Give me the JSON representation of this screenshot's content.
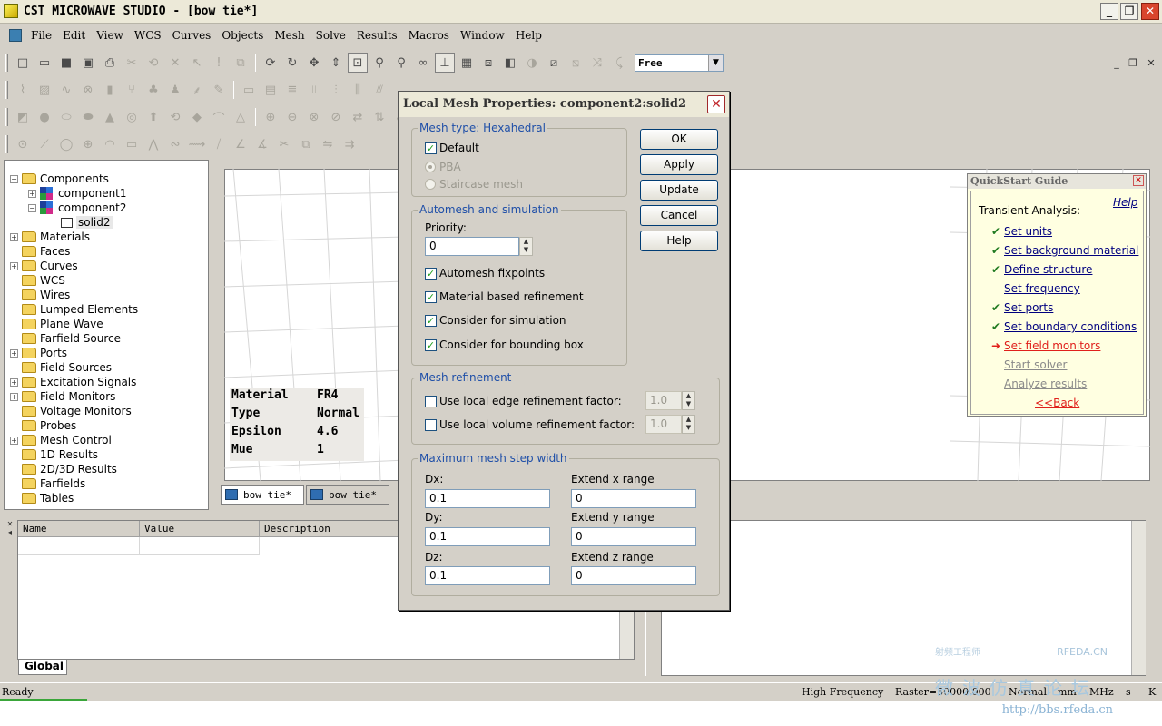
{
  "window": {
    "title": "CST MICROWAVE STUDIO - [bow tie*]",
    "min_glyph": "_",
    "max_glyph": "❐",
    "close_glyph": "✕"
  },
  "menu": [
    "File",
    "Edit",
    "View",
    "WCS",
    "Curves",
    "Objects",
    "Mesh",
    "Solve",
    "Results",
    "Macros",
    "Window",
    "Help"
  ],
  "toolbar": {
    "mode_combo": "Free",
    "combo_arrow": "▼"
  },
  "tree": {
    "items": [
      {
        "label": "Components",
        "exp": "−"
      },
      {
        "label": "component1",
        "exp": "+"
      },
      {
        "label": "component2",
        "exp": "−"
      },
      {
        "label": "solid2",
        "exp": ""
      },
      {
        "label": "Materials",
        "exp": "+"
      },
      {
        "label": "Faces",
        "exp": ""
      },
      {
        "label": "Curves",
        "exp": "+"
      },
      {
        "label": "WCS",
        "exp": ""
      },
      {
        "label": "Wires",
        "exp": ""
      },
      {
        "label": "Lumped Elements",
        "exp": ""
      },
      {
        "label": "Plane Wave",
        "exp": ""
      },
      {
        "label": "Farfield Source",
        "exp": ""
      },
      {
        "label": "Ports",
        "exp": "+"
      },
      {
        "label": "Field Sources",
        "exp": ""
      },
      {
        "label": "Excitation Signals",
        "exp": "+"
      },
      {
        "label": "Field Monitors",
        "exp": "+"
      },
      {
        "label": "Voltage Monitors",
        "exp": ""
      },
      {
        "label": "Probes",
        "exp": ""
      },
      {
        "label": "Mesh Control",
        "exp": "+"
      },
      {
        "label": "1D Results",
        "exp": ""
      },
      {
        "label": "2D/3D Results",
        "exp": ""
      },
      {
        "label": "Farfields",
        "exp": ""
      },
      {
        "label": "Tables",
        "exp": ""
      }
    ]
  },
  "material_info": {
    "rows": [
      {
        "key": "Material",
        "value": "FR4"
      },
      {
        "key": "Type",
        "value": "Normal"
      },
      {
        "key": "Epsilon",
        "value": "4.6"
      },
      {
        "key": "Mue",
        "value": "1"
      }
    ]
  },
  "doc_tabs": [
    "bow tie*",
    "bow tie*"
  ],
  "params": {
    "columns": [
      "Name",
      "Value",
      "Description"
    ],
    "tab": "Global"
  },
  "quickstart": {
    "title": "QuickStart Guide",
    "help": "Help",
    "heading": "Transient Analysis:",
    "steps": [
      {
        "label": "Set units",
        "state": "done",
        "mark": "✔"
      },
      {
        "label": "Set background material",
        "state": "done",
        "mark": "✔"
      },
      {
        "label": "Define structure",
        "state": "done",
        "mark": "✔"
      },
      {
        "label": "Set frequency",
        "state": "todo",
        "mark": ""
      },
      {
        "label": "Set ports",
        "state": "done",
        "mark": "✔"
      },
      {
        "label": "Set boundary conditions",
        "state": "done",
        "mark": "✔"
      },
      {
        "label": "Set field monitors",
        "state": "active",
        "mark": "➜"
      },
      {
        "label": "Start solver",
        "state": "disabled",
        "mark": ""
      },
      {
        "label": "Analyze results",
        "state": "disabled",
        "mark": ""
      }
    ],
    "back": "<<Back",
    "close_glyph": "✕"
  },
  "dialog": {
    "title": "Local Mesh Properties: component2:solid2",
    "close_glyph": "✕",
    "mesh_type": {
      "label": "Mesh type: Hexahedral",
      "default_label": "Default",
      "pba_label": "PBA",
      "staircase_label": "Staircase mesh"
    },
    "automesh": {
      "label": "Automesh and simulation",
      "priority_label": "Priority:",
      "priority_value": "0",
      "fixpoints_label": "Automesh fixpoints",
      "material_refinement_label": "Material based refinement",
      "consider_simulation_label": "Consider for simulation",
      "consider_bbox_label": "Consider for bounding box"
    },
    "refinement": {
      "label": "Mesh refinement",
      "edge_label": "Use local edge refinement factor:",
      "edge_value": "1.0",
      "volume_label": "Use local volume refinement factor:",
      "volume_value": "1.0"
    },
    "step_width": {
      "label": "Maximum mesh step width",
      "dx_label": "Dx:",
      "dx_value": "0.1",
      "dy_label": "Dy:",
      "dy_value": "0.1",
      "dz_label": "Dz:",
      "dz_value": "0.1",
      "ex_label": "Extend x range",
      "ex_value": "0",
      "ey_label": "Extend y range",
      "ey_value": "0",
      "ez_label": "Extend z range",
      "ez_value": "0"
    },
    "buttons": {
      "ok": "OK",
      "apply": "Apply",
      "update": "Update",
      "cancel": "Cancel",
      "help": "Help"
    },
    "check_glyph": "✓"
  },
  "status": {
    "ready": "Ready",
    "mode": "High Frequency",
    "raster": "Raster=50000.000",
    "normal": "Normal",
    "mm": "mm",
    "mhz": "MHz",
    "s": "s",
    "k": "K"
  },
  "watermark": {
    "site": "RFEDA.CN",
    "url": "http://bbs.rfeda.cn",
    "small": "射频工程师",
    "big": "微波仿真论坛"
  }
}
